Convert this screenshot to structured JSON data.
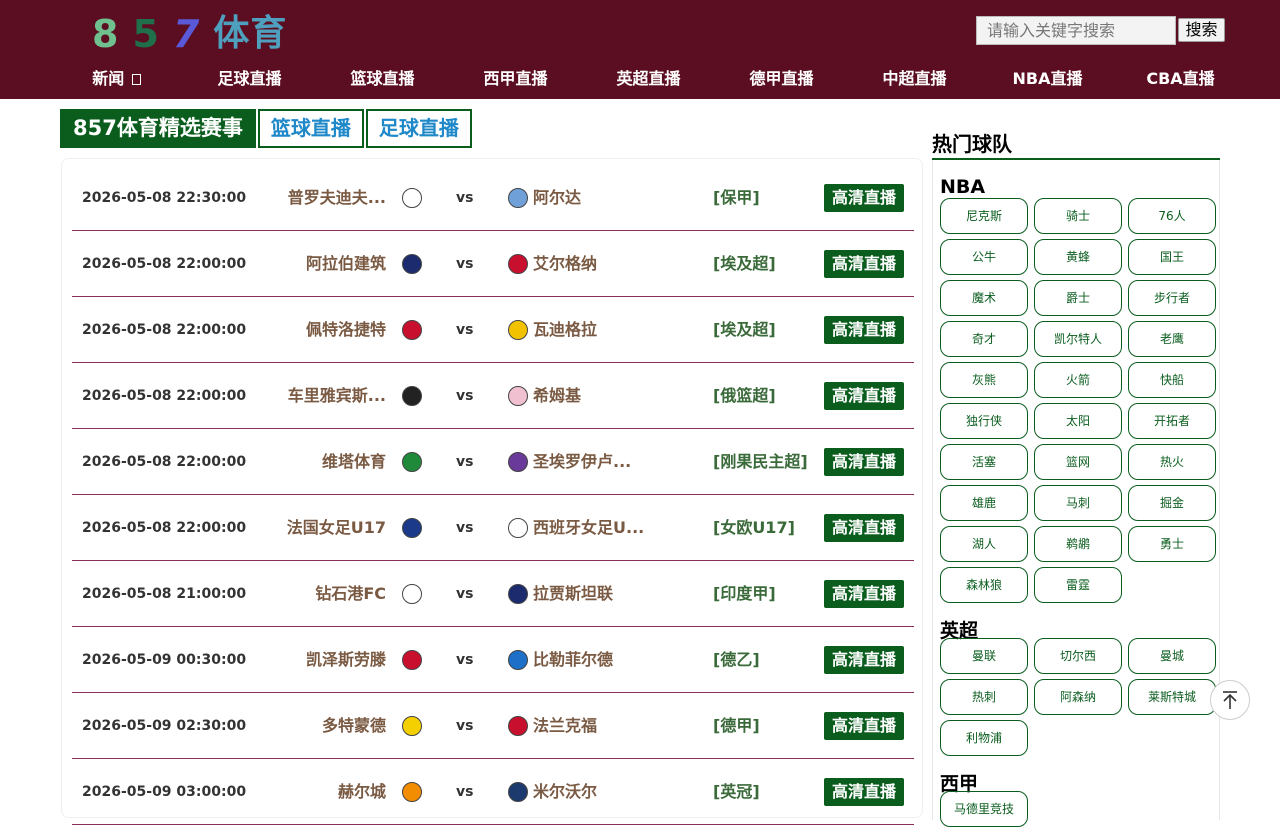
{
  "header": {
    "logo": {
      "d1": "8",
      "d2": "5",
      "d3": "7",
      "cn": "体育"
    },
    "search": {
      "placeholder": "请输入关键字搜索",
      "button": "搜索"
    },
    "nav": [
      "新闻 ",
      "足球直播",
      "篮球直播",
      "西甲直播",
      "英超直播",
      "德甲直播",
      "中超直播",
      "NBA直播",
      "CBA直播"
    ]
  },
  "tabs": {
    "main": "857体育精选赛事",
    "items": [
      "篮球直播",
      "足球直播"
    ]
  },
  "matches": [
    {
      "time": "2026-05-08 22:30:00",
      "home": "普罗夫迪夫...",
      "vs": "vs",
      "away": "阿尔达",
      "league": "[保甲]",
      "btn": "高清直播"
    },
    {
      "time": "2026-05-08 22:00:00",
      "home": "阿拉伯建筑",
      "vs": "vs",
      "away": "艾尔格纳",
      "league": "[埃及超]",
      "btn": "高清直播"
    },
    {
      "time": "2026-05-08 22:00:00",
      "home": "佩特洛捷特",
      "vs": "vs",
      "away": "瓦迪格拉",
      "league": "[埃及超]",
      "btn": "高清直播"
    },
    {
      "time": "2026-05-08 22:00:00",
      "home": "车里雅宾斯...",
      "vs": "vs",
      "away": "希姆基",
      "league": "[俄篮超]",
      "btn": "高清直播"
    },
    {
      "time": "2026-05-08 22:00:00",
      "home": "维塔体育",
      "vs": "vs",
      "away": "圣埃罗伊卢...",
      "league": "[刚果民主超]",
      "btn": "高清直播"
    },
    {
      "time": "2026-05-08 22:00:00",
      "home": "法国女足U17",
      "vs": "vs",
      "away": "西班牙女足U...",
      "league": "[女欧U17]",
      "btn": "高清直播"
    },
    {
      "time": "2026-05-08 21:00:00",
      "home": "钻石港FC",
      "vs": "vs",
      "away": "拉贾斯坦联",
      "league": "[印度甲]",
      "btn": "高清直播"
    },
    {
      "time": "2026-05-09 00:30:00",
      "home": "凯泽斯劳滕",
      "vs": "vs",
      "away": "比勒菲尔德",
      "league": "[德乙]",
      "btn": "高清直播"
    },
    {
      "time": "2026-05-09 02:30:00",
      "home": "多特蒙德",
      "vs": "vs",
      "away": "法兰克福",
      "league": "[德甲]",
      "btn": "高清直播"
    },
    {
      "time": "2026-05-09 03:00:00",
      "home": "赫尔城",
      "vs": "vs",
      "away": "米尔沃尔",
      "league": "[英冠]",
      "btn": "高清直播"
    }
  ],
  "logo_colors": {
    "home": [
      "#ffffff",
      "#1c2a6e",
      "#c8102e",
      "#222222",
      "#1f8a3a",
      "#1c3a8a",
      "#ffffff",
      "#c8102e",
      "#f5d000",
      "#f28c00"
    ],
    "away": [
      "#6fa0d8",
      "#c8102e",
      "#f2c200",
      "#f0c0d0",
      "#6a3a9a",
      "#ffffff",
      "#1c2a6e",
      "#1e6fc8",
      "#c8102e",
      "#1c3a6e"
    ]
  },
  "sidebar": {
    "title": "热门球队",
    "groups": [
      {
        "name": "NBA",
        "teams": [
          "尼克斯",
          "骑士",
          "76人",
          "公牛",
          "黄蜂",
          "国王",
          "魔术",
          "爵士",
          "步行者",
          "奇才",
          "凯尔特人",
          "老鹰",
          "灰熊",
          "火箭",
          "快船",
          "独行侠",
          "太阳",
          "开拓者",
          "活塞",
          "篮网",
          "热火",
          "雄鹿",
          "马刺",
          "掘金",
          "湖人",
          "鹈鹕",
          "勇士",
          "森林狼",
          "雷霆"
        ]
      },
      {
        "name": "英超",
        "teams": [
          "曼联",
          "切尔西",
          "曼城",
          "热刺",
          "阿森纳",
          "莱斯特城",
          "利物浦"
        ]
      },
      {
        "name": "西甲",
        "teams": [
          "马德里竞技"
        ]
      }
    ]
  },
  "colors": {
    "header_bg": "#5b0e21",
    "accent_green": "#0b5d1e",
    "tab_blue": "#1e88c8",
    "row_divider": "#8b2f5a"
  }
}
